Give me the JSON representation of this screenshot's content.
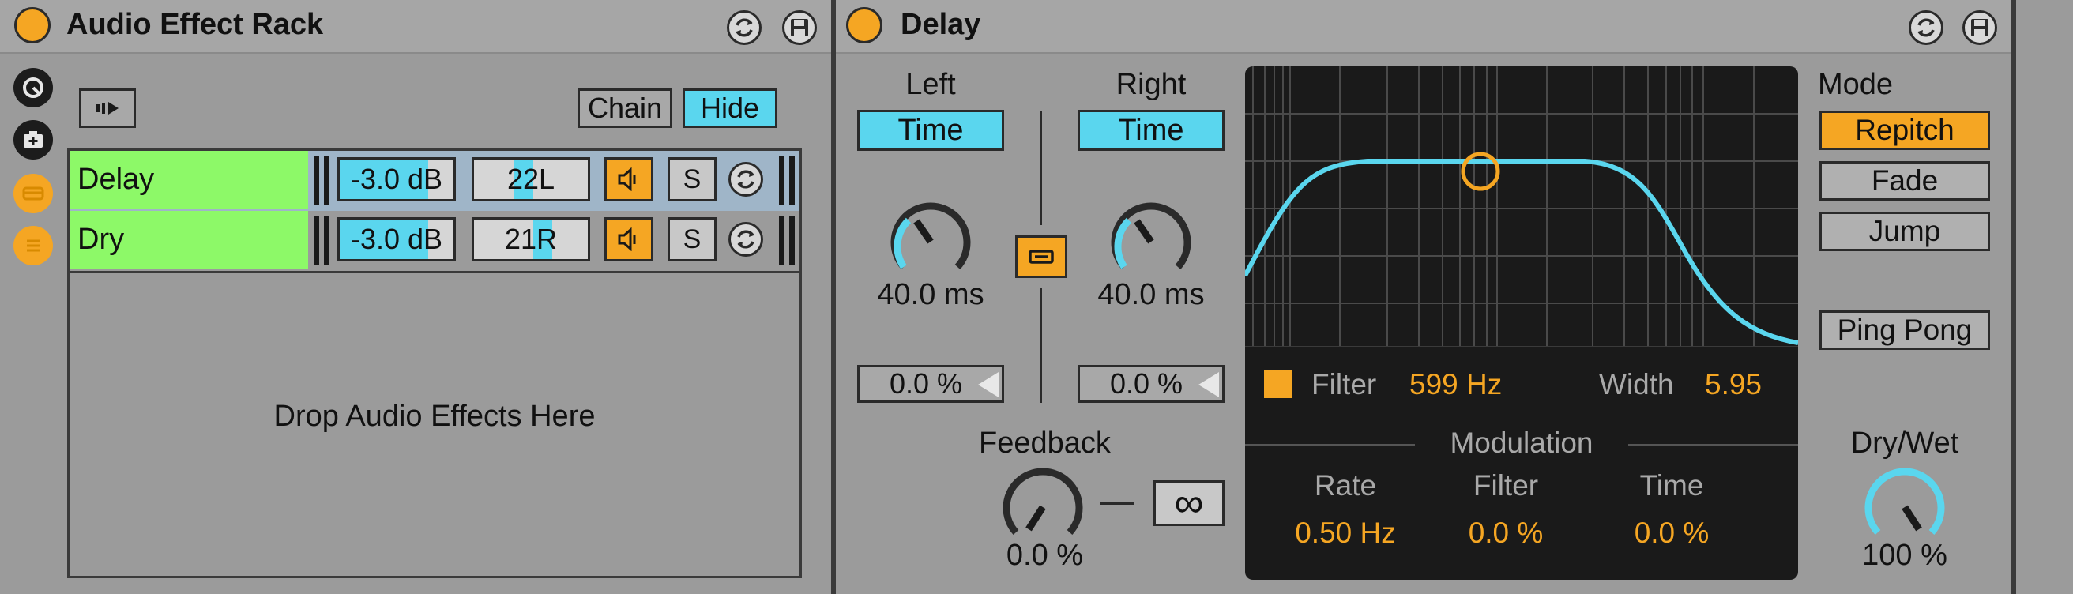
{
  "rack": {
    "title": "Audio Effect Rack",
    "chain_label": "Chain",
    "hide_label": "Hide",
    "drop_text": "Drop Audio Effects Here",
    "chains": [
      {
        "name": "Delay",
        "volume": "-3.0 dB",
        "volume_fraction": 0.78,
        "pan": "22L",
        "solo": "S",
        "selected": true
      },
      {
        "name": "Dry",
        "volume": "-3.0 dB",
        "volume_fraction": 0.78,
        "pan": "21R",
        "solo": "S",
        "selected": false
      }
    ]
  },
  "delay": {
    "title": "Delay",
    "left": {
      "label": "Left",
      "time_label": "Time",
      "time_value": "40.0 ms",
      "offset": "0.0 %"
    },
    "right": {
      "label": "Right",
      "time_label": "Time",
      "time_value": "40.0 ms",
      "offset": "0.0 %"
    },
    "feedback": {
      "label": "Feedback",
      "value": "0.0 %",
      "freeze_symbol": "∞"
    },
    "filter": {
      "label": "Filter",
      "freq": "599 Hz",
      "width_label": "Width",
      "width": "5.95",
      "modulation_label": "Modulation",
      "rate_label": "Rate",
      "rate": "0.50 Hz",
      "mod_filter_label": "Filter",
      "mod_filter": "0.0 %",
      "mod_time_label": "Time",
      "mod_time": "0.0 %"
    },
    "mode": {
      "label": "Mode",
      "options": [
        "Repitch",
        "Fade",
        "Jump"
      ],
      "selected": "Repitch",
      "ping_pong": "Ping Pong"
    },
    "dry_wet": {
      "label": "Dry/Wet",
      "value": "100 %"
    }
  },
  "colors": {
    "accent_orange": "#f5a623",
    "accent_blue": "#5ad6ee",
    "chain_green": "#8df968"
  }
}
